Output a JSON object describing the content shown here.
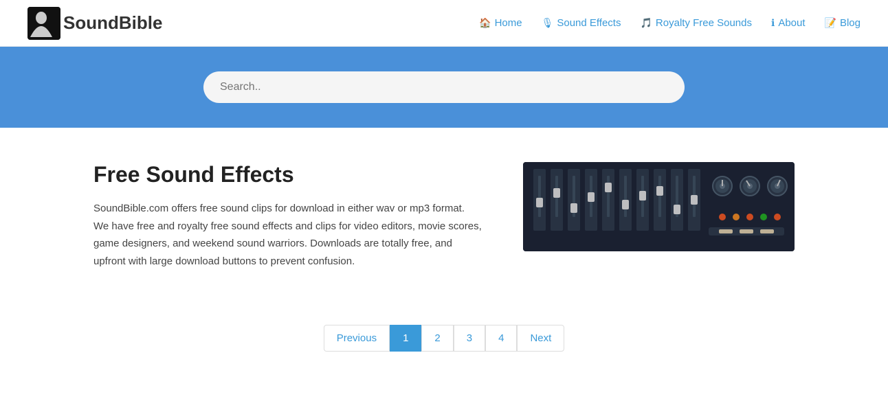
{
  "brand": {
    "logo_text_plain": "Sound",
    "logo_text_bold": "Bible",
    "full_name": "SoundBible"
  },
  "nav": {
    "items": [
      {
        "id": "home",
        "label": "Home",
        "icon": "🏠"
      },
      {
        "id": "sound-effects",
        "label": "Sound Effects",
        "icon": "🎙"
      },
      {
        "id": "royalty-free",
        "label": "Royalty Free Sounds",
        "icon": "🎵"
      },
      {
        "id": "about",
        "label": "About",
        "icon": "ℹ"
      },
      {
        "id": "blog",
        "label": "Blog",
        "icon": "📝"
      }
    ]
  },
  "search": {
    "placeholder": "Search.."
  },
  "hero": {
    "title": "Free Sound Effects",
    "body": "SoundBible.com offers free sound clips for download in either wav or mp3 format. We have free and royalty free sound effects and clips for video editors, movie scores, game designers, and weekend sound warriors. Downloads are totally free, and upfront with large download buttons to prevent confusion."
  },
  "pagination": {
    "previous_label": "Previous",
    "next_label": "Next",
    "pages": [
      "1",
      "2",
      "3",
      "4"
    ],
    "active_page": "1"
  },
  "colors": {
    "accent": "#3a9ad9",
    "banner_bg": "#4a90d9",
    "active_page_bg": "#3a9ad9"
  }
}
